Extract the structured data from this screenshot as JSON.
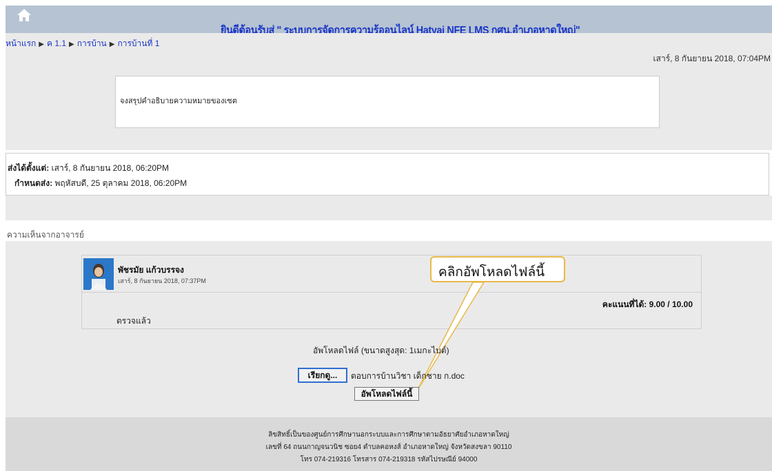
{
  "header": {
    "home_icon": "home-icon",
    "site_title": "ยินดีต้อนรับสู่ \" ระบบการจัดการความรู้ออนไลน์ Hatyai NFE LMS กศน.อำเภอหาดใหญ่\"",
    "bg_color": "#b6c3d2",
    "title_color": "#1a35c8"
  },
  "breadcrumb": {
    "items": [
      "หน้าแรก",
      "ค 1.1",
      "การบ้าน",
      "การบ้านที่ 1"
    ],
    "separator": "▶"
  },
  "assignment": {
    "current_datetime": "เสาร์, 8 กันยายน 2018, 07:04PM",
    "description": "จงสรุปคำอธิบายความหมายของเซต",
    "available_from_label": "ส่งได้ตั้งแต่:",
    "available_from_value": "เสาร์, 8 กันยายน 2018, 06:20PM",
    "due_label": "กำหนดส่ง:",
    "due_value": "พฤหัสบดี, 25 ตุลาคม 2018, 06:20PM"
  },
  "feedback": {
    "section_title": "ความเห็นจากอาจารย์",
    "teacher_name": "พัชรมัย แก้วบรรจง",
    "comment_date": "เสาร์, 8 กันยายน 2018, 07:37PM",
    "score_label": "คะแนนที่ได้: 9.00 / 10.00",
    "comment": "ตรวจแล้ว"
  },
  "callout": {
    "text": "คลิกอัพโหลดไฟล์นี้",
    "border_color": "#e8b84a"
  },
  "upload": {
    "label": "อัพโหลดไฟล์ (ขนาดสูงสุด: 1เมกะไบต์)",
    "browse_label": "เรียกดู...",
    "file_name": "ตอบการบ้านวิชา เด็กชาย ก.doc",
    "upload_label": "อัพโหลดไฟล์นี้"
  },
  "footer": {
    "line1": "ลิขสิทธิ์เป็นของศูนย์การศึกษานอกระบบและการศึกษาตามอัธยาศัยอำเภอหาดใหญ่",
    "line2": "เลขที่ 64 ถนนกาญจนวนิช ซอย4 ตำบลคอหงส์ อำเภอหาดใหญ่ จังหวัดสงขลา 90110",
    "line3": "โทร 074-219316 โทรสาร 074-219318 รหัสไปรษณีย์ 94000"
  }
}
